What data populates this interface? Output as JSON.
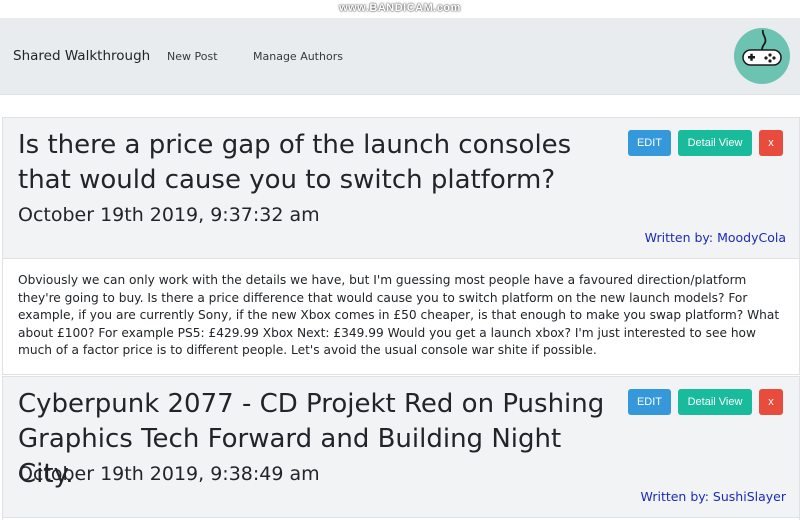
{
  "watermark": "www.BANDICAM.com",
  "navbar": {
    "brand": "Shared Walkthrough",
    "links": [
      {
        "label": "New Post"
      },
      {
        "label": "Manage Authors"
      }
    ],
    "logo_icon": "gamepad-icon"
  },
  "buttons": {
    "edit": "EDIT",
    "detail": "Detail View",
    "delete": "x"
  },
  "posts": [
    {
      "title": "Is there a price gap of the launch consoles that would cause you to switch platform?",
      "date": "October 19th 2019, 9:37:32 am",
      "author": "Written by: MoodyCola",
      "body": "Obviously we can only work with the details we have, but I'm guessing most people have a favoured direction/platform they're going to buy. Is there a price difference that would cause you to switch platform on the new launch models? For example, if you are currently Sony, if the new Xbox comes in £50 cheaper, is that enough to make you swap platform? What about £100? For example PS5: £429.99 Xbox Next: £349.99 Would you get a launch xbox? I'm just interested to see how much of a factor price is to different people. Let's avoid the usual console war shite if possible."
    },
    {
      "title": "Cyberpunk 2077 - CD Projekt Red on Pushing Graphics Tech Forward and Building Night City.",
      "date": "October 19th 2019, 9:38:49 am",
      "author": "Written by: SushiSlayer"
    }
  ],
  "colors": {
    "edit": "#3498db",
    "detail": "#18bc9c",
    "delete": "#e74c3c",
    "logo_bg": "#6cc3b1",
    "author_link": "#1a2bb8"
  }
}
